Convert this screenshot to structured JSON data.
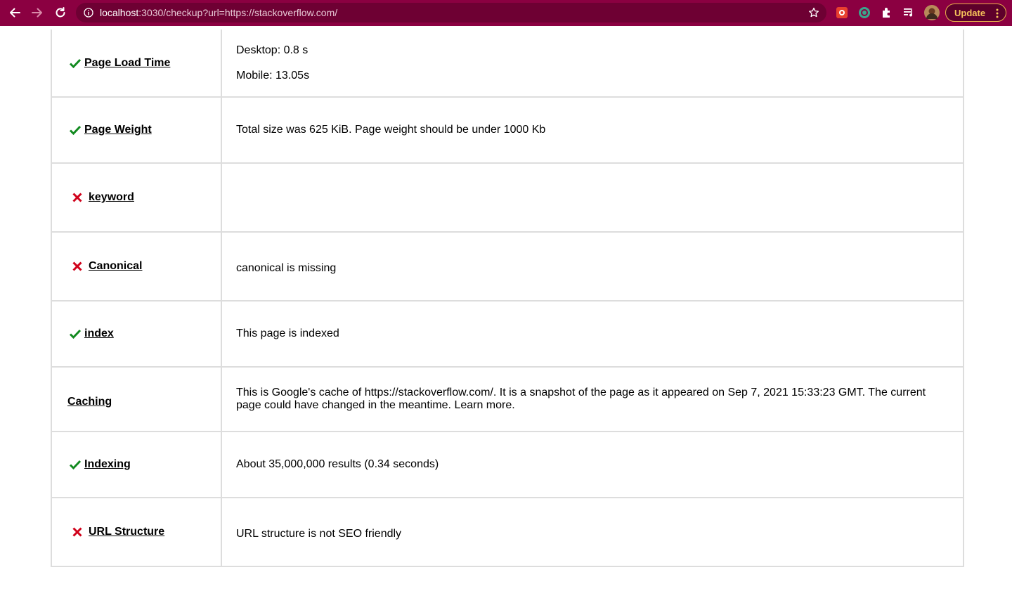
{
  "browser": {
    "url_host": "localhost",
    "url_rest": ":3030/checkup?url=https://stackoverflow.com/",
    "update_label": "Update",
    "theme_color": "#8b0041"
  },
  "rows": [
    {
      "name": "Page Load Time",
      "status": "pass",
      "values": [
        "Desktop: 0.8 s",
        "Mobile: 13.05s"
      ]
    },
    {
      "name": "Page Weight",
      "status": "pass",
      "values": [
        "Total size was 625 KiB. Page weight should be under 1000 Kb"
      ]
    },
    {
      "name": "keyword",
      "status": "fail",
      "values": []
    },
    {
      "name": "Canonical",
      "status": "fail",
      "values": [
        "canonical is missing"
      ]
    },
    {
      "name": "index",
      "status": "pass",
      "values": [
        "This page is indexed"
      ]
    },
    {
      "name": "Caching",
      "status": "none",
      "values": [
        "This is Google's cache of https://stackoverflow.com/. It is a snapshot of the page as it appeared on Sep 7, 2021 15:33:23 GMT. The current page could have changed in the meantime. Learn more."
      ]
    },
    {
      "name": "Indexing",
      "status": "pass",
      "values": [
        "About 35,000,000 results (0.34 seconds)"
      ]
    },
    {
      "name": "URL Structure",
      "status": "fail",
      "values": [
        "URL structure is not SEO friendly"
      ]
    }
  ],
  "colors": {
    "pass": "#118a1f",
    "fail": "#d0021b",
    "border": "#dddddd"
  },
  "icons": {
    "pass": "check-icon",
    "fail": "cross-icon"
  }
}
